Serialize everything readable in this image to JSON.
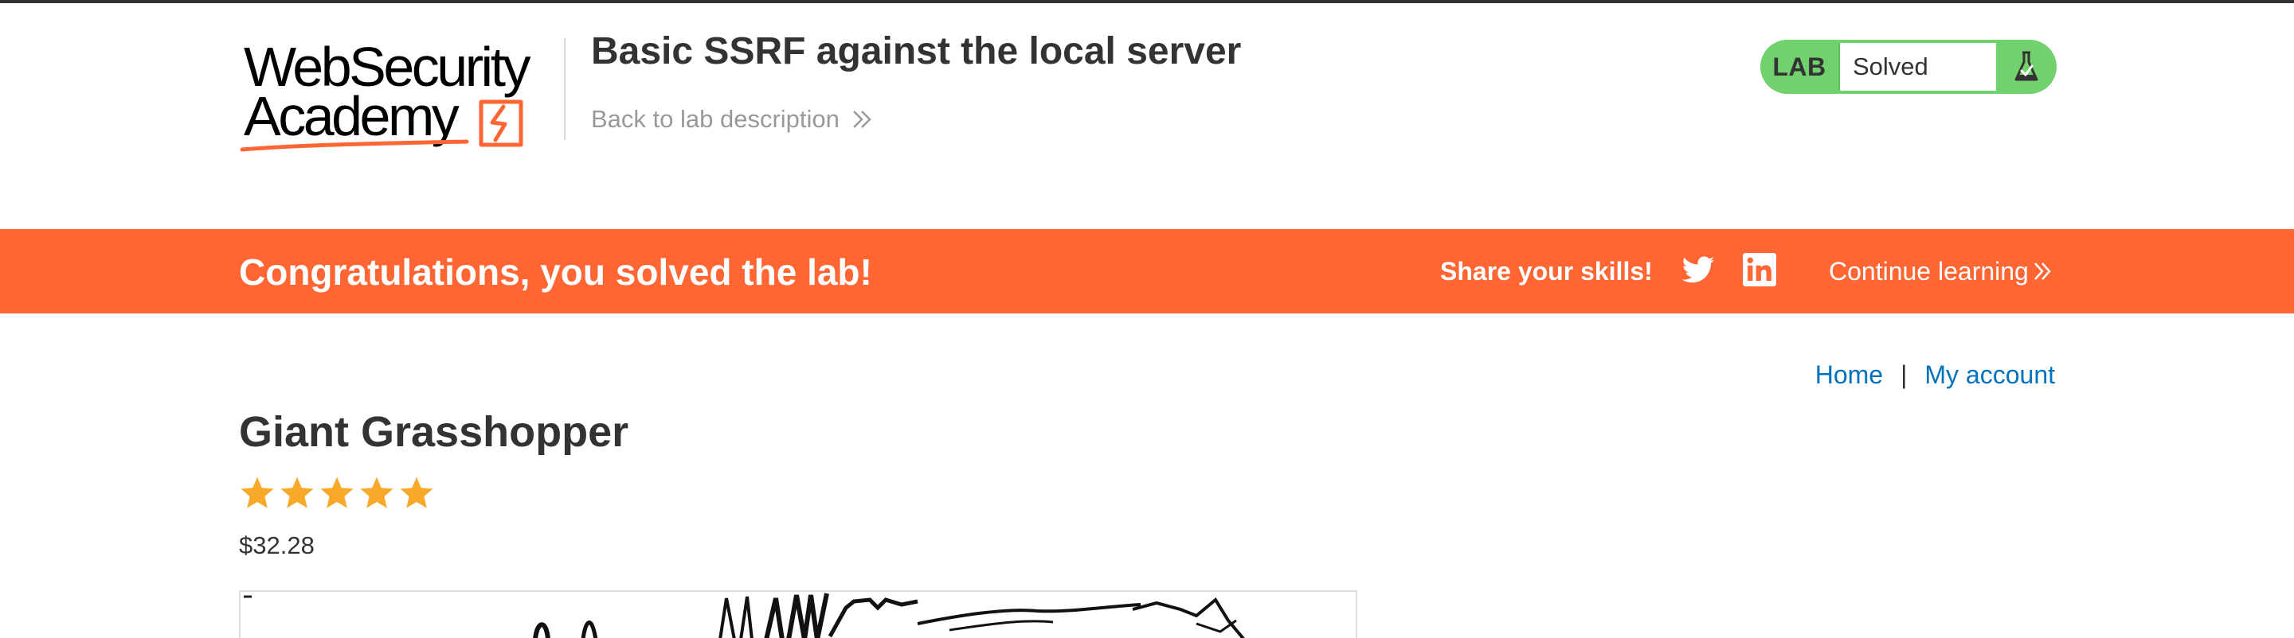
{
  "header": {
    "logo_line1": "WebSecurity",
    "logo_line2": "Academy",
    "lab_title": "Basic SSRF against the local server",
    "back_link": "Back to lab description",
    "lab_status": {
      "label": "LAB",
      "state": "Solved",
      "status_color": "#70d16d"
    }
  },
  "notification": {
    "message": "Congratulations, you solved the lab!",
    "share_label": "Share your skills!",
    "continue_label": "Continue learning",
    "icons": [
      "twitter-icon",
      "linkedin-icon"
    ],
    "background_color": "#ff6633"
  },
  "nav": {
    "home": "Home",
    "separator": "|",
    "account": "My account"
  },
  "product": {
    "title": "Giant Grasshopper",
    "rating": 5,
    "rating_max": 5,
    "price": "$32.28"
  },
  "colors": {
    "brand_orange": "#ff6633",
    "link_blue": "#0071bc",
    "star_gold": "#f8a92a",
    "text": "#333333"
  }
}
